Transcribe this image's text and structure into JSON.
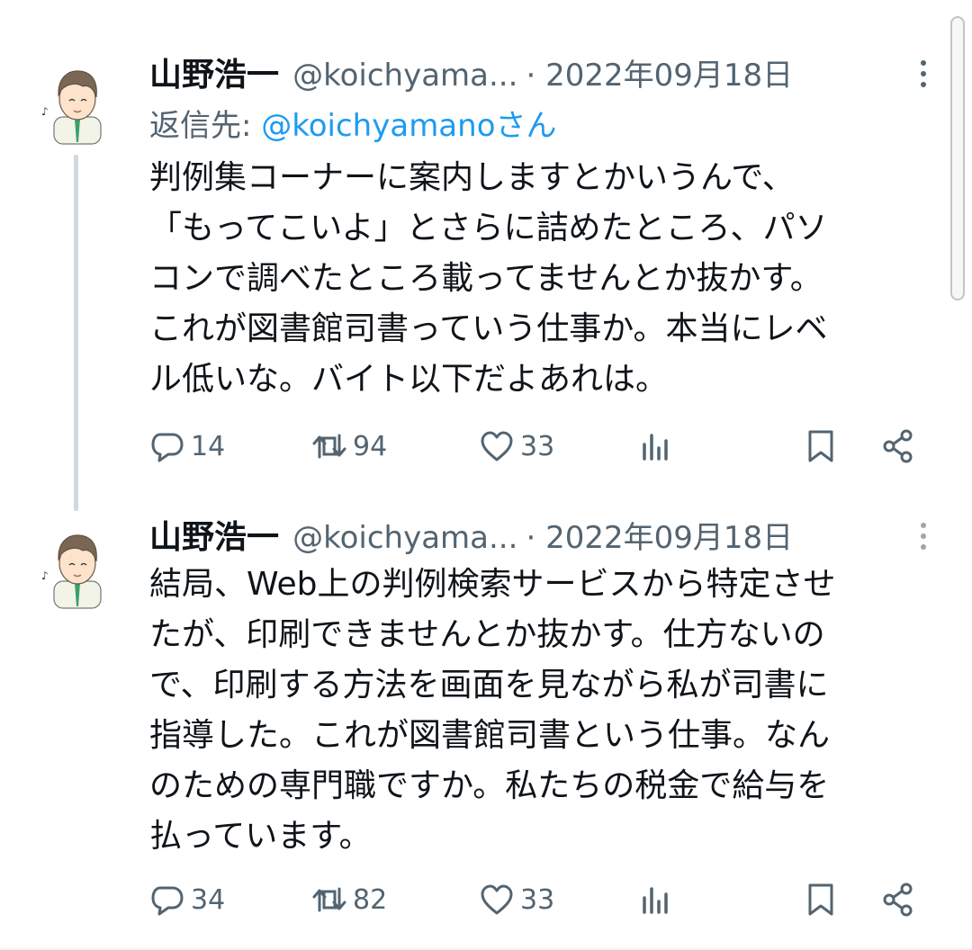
{
  "thread": [
    {
      "author": {
        "name": "山野浩一",
        "handle": "@koichyama...",
        "date": "· 2022年09月18日"
      },
      "reply_to": {
        "prefix": "返信先: ",
        "mention": "@koichyamanoさん"
      },
      "text_lines": [
        "判例集コーナーに案内しますとかいうんで、",
        "「もってこいよ」とさらに詰めたところ、パソ",
        "コンで調べたところ載ってませんとか抜かす。",
        "これが図書館司書っていう仕事か。本当にレベ",
        "ル低いな。バイト以下だよあれは。"
      ],
      "stats": {
        "replies": "14",
        "retweets": "94",
        "likes": "33"
      }
    },
    {
      "author": {
        "name": "山野浩一",
        "handle": "@koichyama...",
        "date": "· 2022年09月18日"
      },
      "text_lines": [
        "結局、Web上の判例検索サービスから特定させ",
        "たが、印刷できませんとか抜かす。仕方ないの",
        "で、印刷する方法を画面を見ながら私が司書に",
        "指導した。これが図書館司書という仕事。なん",
        "のための専門職ですか。私たちの税金で給与を",
        "払っています。"
      ],
      "stats": {
        "replies": "34",
        "retweets": "82",
        "likes": "33"
      }
    }
  ],
  "icons": {
    "reply": "speech-bubble-icon",
    "retweet": "retweet-icon",
    "like": "heart-icon",
    "views": "bar-chart-icon",
    "bookmark": "bookmark-icon",
    "share": "share-icon",
    "more": "vertical-dots-icon"
  },
  "colors": {
    "link": "#1d9bf0",
    "secondary": "#536471",
    "text": "#0f1419",
    "thread_line": "#cfd9de"
  }
}
